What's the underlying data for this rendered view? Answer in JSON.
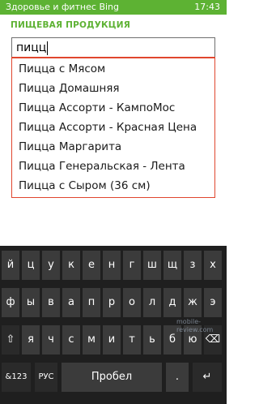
{
  "status_bar": {
    "app_title": "Здоровье и фитнес Bing",
    "time": "17:43"
  },
  "section": {
    "title": "ПИЩЕВАЯ ПРОДУКЦИЯ"
  },
  "search": {
    "value": "пицц"
  },
  "suggestions": [
    "Пицца с Мясом",
    "Пицца Домашняя",
    "Пицца Ассорти - КампоМос",
    "Пицца Ассорти - Красная Цена",
    "Пицца Маргарита",
    "Пицца Генеральская - Лента",
    "Пицца с Сыром (36 см)"
  ],
  "keyboard": {
    "row1": [
      "й",
      "ц",
      "у",
      "к",
      "е",
      "н",
      "г",
      "ш",
      "щ",
      "з",
      "х"
    ],
    "row2": [
      "ф",
      "ы",
      "в",
      "а",
      "п",
      "р",
      "о",
      "л",
      "д",
      "ж",
      "э"
    ],
    "row3": [
      "⇧",
      "я",
      "ч",
      "с",
      "м",
      "и",
      "т",
      "ь",
      "б",
      "ю",
      "⌫"
    ],
    "row4": {
      "symbols": "&123",
      "language": "РУС",
      "space": "Пробел",
      "period": ".",
      "enter": "↵"
    }
  },
  "watermark": "mobile-review.com",
  "colors": {
    "accent": "#5db233",
    "highlight_border": "#e0462e"
  }
}
